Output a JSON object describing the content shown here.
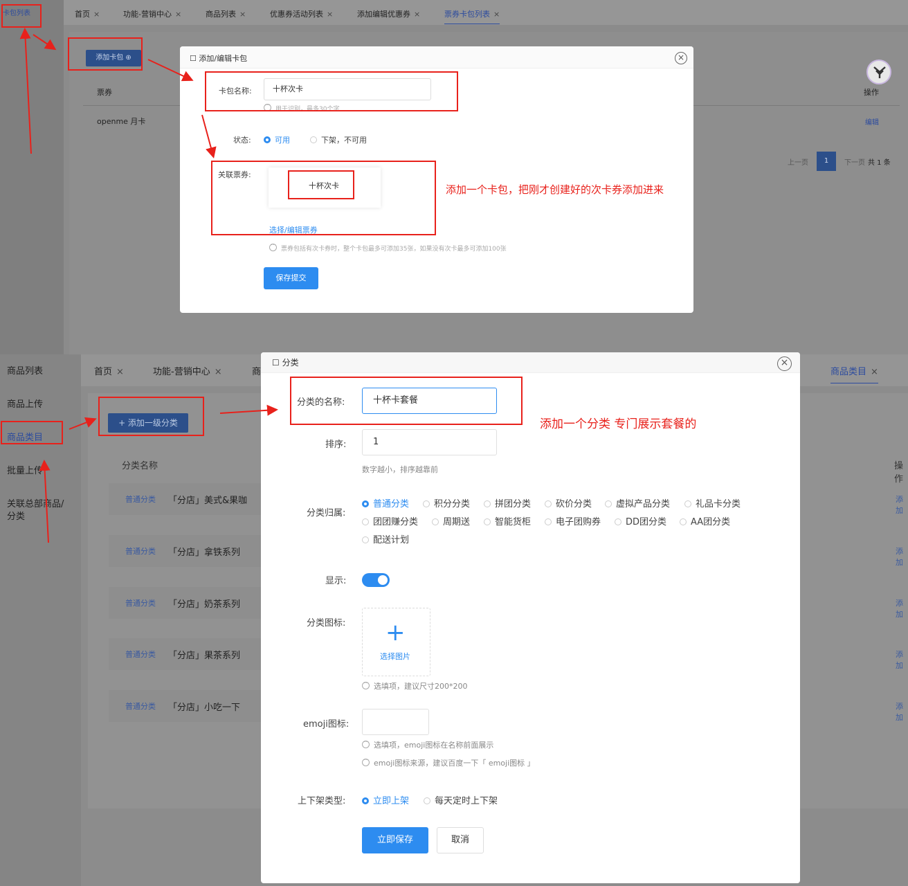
{
  "top": {
    "sidebar_item": "卡包列表",
    "tabs": [
      {
        "label": "首页",
        "close": "×"
      },
      {
        "label": "功能-营销中心",
        "close": "×"
      },
      {
        "label": "商品列表",
        "close": "×"
      },
      {
        "label": "优惠券活动列表",
        "close": "×"
      },
      {
        "label": "添加编辑优惠券",
        "close": "×"
      },
      {
        "label": "票券卡包列表",
        "close": "×"
      }
    ],
    "add_button": "添加卡包 ⊕",
    "table": {
      "col_coupon": "票券",
      "col_ops": "操作",
      "row_name": "openme 月卡",
      "row_edit": "编辑"
    },
    "pager": {
      "prev": "上一页",
      "page": "1",
      "next": "下一页",
      "total": "共 1 条"
    },
    "modal": {
      "title": "添加/编辑卡包",
      "close": "×",
      "name_label": "卡包名称:",
      "name_value": "十杯次卡",
      "name_hint": "用于识别，最多30个字",
      "status_label": "状态:",
      "status_on": "可用",
      "status_off": "下架，不可用",
      "linked_label": "关联票券:",
      "linked_card": "十杯次卡",
      "select_link": "选择/编辑票券",
      "linked_hint": "票券包括有次卡券时，整个卡包最多可添加35张，如果没有次卡最多可添加100张",
      "save": "保存提交"
    },
    "annotation": "添加一个卡包，把刚才创建好的次卡券添加进来"
  },
  "bottom": {
    "sidebar": [
      "商品列表",
      "商品上传",
      "商品类目",
      "批量上传",
      "关联总部商品/",
      "分类"
    ],
    "tabs": [
      {
        "label": "首页",
        "close": "×"
      },
      {
        "label": "功能-营销中心",
        "close": "×"
      },
      {
        "label": "商",
        "close": ""
      },
      {
        "label": "商品类目",
        "close": "×"
      }
    ],
    "add_button": "+ 添加一级分类",
    "table": {
      "col_name": "分类名称",
      "col_ops": "操作",
      "rows": [
        {
          "tag": "普通分类",
          "name": "「分店」美式&果咖",
          "op": "添加"
        },
        {
          "tag": "普通分类",
          "name": "「分店」拿铁系列",
          "op": "添加"
        },
        {
          "tag": "普通分类",
          "name": "「分店」奶茶系列",
          "op": "添加"
        },
        {
          "tag": "普通分类",
          "name": "「分店」果茶系列",
          "op": "添加"
        },
        {
          "tag": "普通分类",
          "name": "「分店」小吃一下",
          "op": "添加"
        }
      ]
    },
    "modal": {
      "title": "分类",
      "close": "×",
      "name_label": "分类的名称:",
      "name_value": "十杯卡套餐",
      "sort_label": "排序:",
      "sort_value": "1",
      "sort_hint": "数字越小，排序越靠前",
      "belong_label": "分类归属:",
      "belong_options": [
        "普通分类",
        "积分分类",
        "拼团分类",
        "砍价分类",
        "虚拟产品分类",
        "礼品卡分类",
        "团团赚分类",
        "周期送",
        "智能货柜",
        "电子团购券",
        "DD团分类",
        "AA团分类",
        "配送计划"
      ],
      "belong_selected": "普通分类",
      "show_label": "显示:",
      "show_on": true,
      "icon_label": "分类图标:",
      "upload_plus": "+",
      "upload_text": "选择图片",
      "icon_hint": "选填项，建议尺寸200*200",
      "emoji_label": "emoji图标:",
      "emoji_hint1": "选填项，emoji图标在名称前面展示",
      "emoji_hint2": "emoji图标来源，建议百度一下「 emoji图标 」",
      "shelf_label": "上下架类型:",
      "shelf_on": "立即上架",
      "shelf_off": "每天定时上下架",
      "save": "立即保存",
      "cancel": "取消"
    },
    "annotation": "添加一个分类 专门展示套餐的"
  },
  "colors": {
    "annotation_red": "#e8211b",
    "primary_blue": "#2d8cf0"
  }
}
